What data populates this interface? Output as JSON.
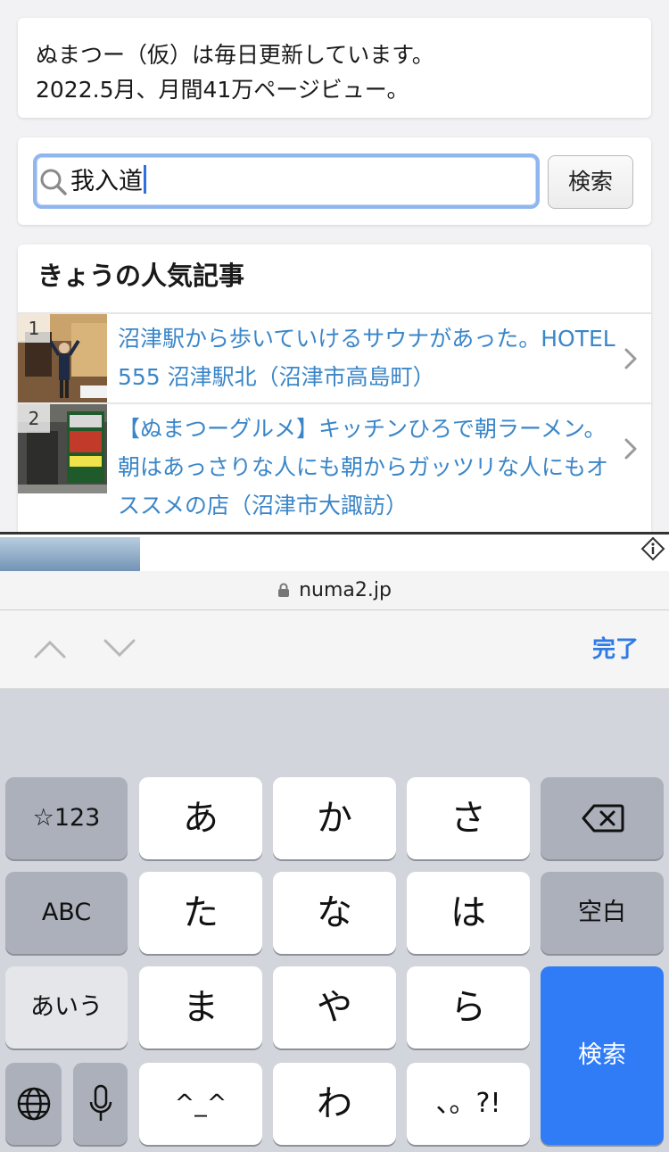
{
  "notice": {
    "line1": "ぬまつー（仮）は毎日更新しています。",
    "line2": "2022.5月、月間41万ページビュー。"
  },
  "search": {
    "query": "我入道",
    "button_label": "検索"
  },
  "popular": {
    "heading": "きょうの人気記事",
    "posts": [
      {
        "rank": "1",
        "title": "沼津駅から歩いていけるサウナがあった。HOTEL 555 沼津駅北（沼津市高島町）"
      },
      {
        "rank": "2",
        "title": "【ぬまつーグルメ】キッチンひろで朝ラーメン。朝はあっさりな人にも朝からガッツリな人にもオススメの店（沼津市大諏訪）"
      }
    ]
  },
  "browser": {
    "url": "numa2.jp"
  },
  "accessory": {
    "done_label": "完了"
  },
  "keyboard": {
    "row1": {
      "mode": "☆123",
      "k1": "あ",
      "k2": "か",
      "k3": "さ"
    },
    "row2": {
      "mode": "ABC",
      "k1": "た",
      "k2": "な",
      "k3": "は",
      "space": "空白"
    },
    "row3": {
      "mode": "あいう",
      "k1": "ま",
      "k2": "や",
      "k3": "ら",
      "enter": "検索"
    },
    "row4": {
      "k1": "^_^",
      "k2": "わ",
      "k3": "、。?!"
    }
  },
  "colors": {
    "link": "#3a86c8",
    "accent": "#2f7cf6",
    "focus_ring": "#8fb6ee"
  }
}
